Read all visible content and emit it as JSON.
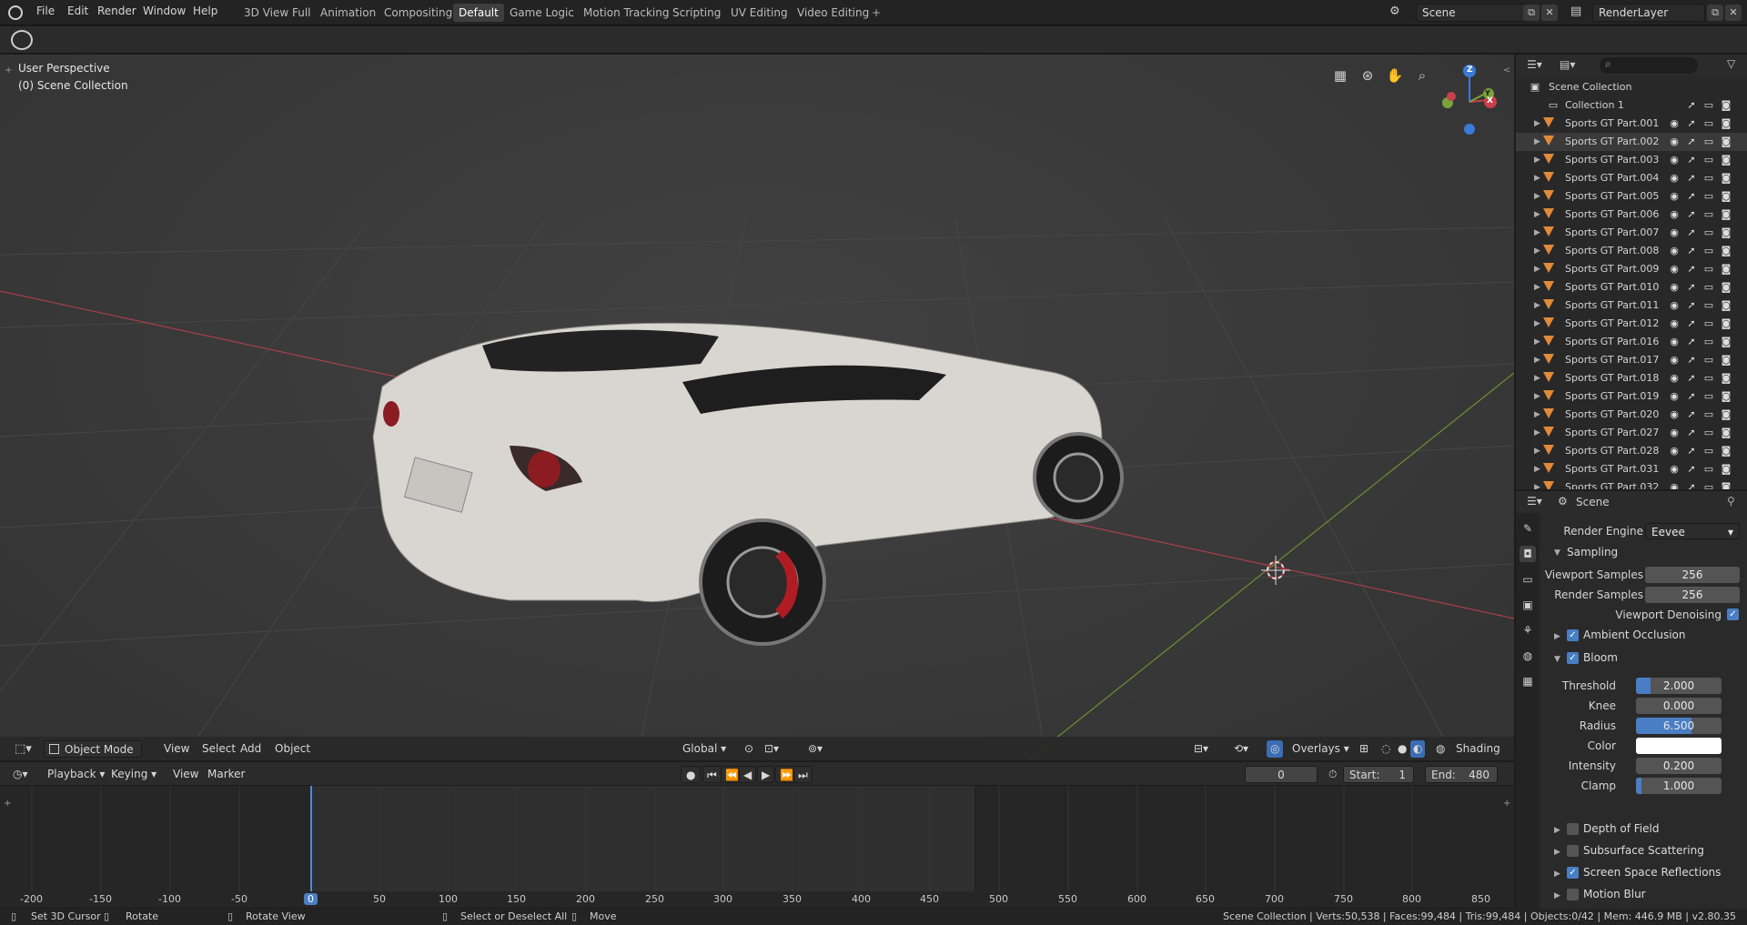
{
  "menu": {
    "file": "File",
    "edit": "Edit",
    "render": "Render",
    "window": "Window",
    "help": "Help"
  },
  "workspaces": [
    "3D View Full",
    "Animation",
    "Compositing",
    "Default",
    "Game Logic",
    "Motion Tracking",
    "Scripting",
    "UV Editing",
    "Video Editing"
  ],
  "active_workspace": "Default",
  "scene_field": "Scene",
  "renderlayer_field": "RenderLayer",
  "viewport": {
    "perspective": "User Perspective",
    "collection": "(0) Scene Collection",
    "gizmo": {
      "z": "Z",
      "y": "Y",
      "x": "X"
    }
  },
  "viewport_header": {
    "mode": "Object Mode",
    "view": "View",
    "select": "Select",
    "add": "Add",
    "object": "Object",
    "transform": "Global",
    "overlays": "Overlays",
    "shading": "Shading"
  },
  "timeline_header": {
    "playback": "Playback",
    "keying": "Keying",
    "view": "View",
    "marker": "Marker",
    "current_frame": "0",
    "start_label": "Start:",
    "start": "1",
    "end_label": "End:",
    "end": "480"
  },
  "timeline_ruler": [
    "-200",
    "-150",
    "-100",
    "-50",
    "0",
    "50",
    "100",
    "150",
    "200",
    "250",
    "300",
    "350",
    "400",
    "450",
    "500",
    "550",
    "600",
    "650",
    "700",
    "750",
    "800",
    "850"
  ],
  "outliner": {
    "root": "Scene Collection",
    "collection": "Collection 1",
    "items": [
      "Sports GT Part.001",
      "Sports GT Part.002",
      "Sports GT Part.003",
      "Sports GT Part.004",
      "Sports GT Part.005",
      "Sports GT Part.006",
      "Sports GT Part.007",
      "Sports GT Part.008",
      "Sports GT Part.009",
      "Sports GT Part.010",
      "Sports GT Part.011",
      "Sports GT Part.012",
      "Sports GT Part.016",
      "Sports GT Part.017",
      "Sports GT Part.018",
      "Sports GT Part.019",
      "Sports GT Part.020",
      "Sports GT Part.027",
      "Sports GT Part.028",
      "Sports GT Part.031",
      "Sports GT Part.032"
    ],
    "selected_index": 1
  },
  "properties": {
    "context": "Scene",
    "render_engine_label": "Render Engine",
    "render_engine": "Eevee",
    "sampling": "Sampling",
    "viewport_samples_label": "Viewport Samples",
    "viewport_samples": "256",
    "render_samples_label": "Render Samples",
    "render_samples": "256",
    "viewport_denoising": "Viewport Denoising",
    "ambient_occlusion": "Ambient Occlusion",
    "bloom": "Bloom",
    "threshold_label": "Threshold",
    "threshold": "2.000",
    "knee_label": "Knee",
    "knee": "0.000",
    "radius_label": "Radius",
    "radius": "6.500",
    "color_label": "Color",
    "intensity_label": "Intensity",
    "intensity": "0.200",
    "clamp_label": "Clamp",
    "clamp": "1.000",
    "depth_of_field": "Depth of Field",
    "subsurface_scattering": "Subsurface Scattering",
    "screen_space_reflections": "Screen Space Reflections",
    "motion_blur": "Motion Blur"
  },
  "statusbar": {
    "set_cursor": "Set 3D Cursor",
    "rotate": "Rotate",
    "rotate_view": "Rotate View",
    "select": "Select or Deselect All",
    "move": "Move",
    "stats": "Scene Collection | Verts:50,538 | Faces:99,484 | Tris:99,484 | Objects:0/42 | Mem: 446.9 MB | v2.80.35"
  },
  "colors": {
    "accent": "#4a7ec4",
    "object_icon": "#e08a3a",
    "x_axis": "#c8404a",
    "y_axis": "#7aa33a",
    "z_axis": "#3a7ad8"
  }
}
